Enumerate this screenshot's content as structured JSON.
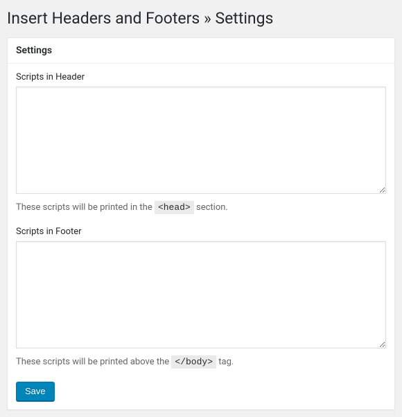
{
  "page": {
    "title": "Insert Headers and Footers » Settings"
  },
  "panel": {
    "heading": "Settings"
  },
  "fields": {
    "header": {
      "label": "Scripts in Header",
      "value": "",
      "desc_before": "These scripts will be printed in the ",
      "desc_code": "<head>",
      "desc_after": " section."
    },
    "footer": {
      "label": "Scripts in Footer",
      "value": "",
      "desc_before": "These scripts will be printed above the ",
      "desc_code": "</body>",
      "desc_after": " tag."
    }
  },
  "actions": {
    "save_label": "Save"
  }
}
